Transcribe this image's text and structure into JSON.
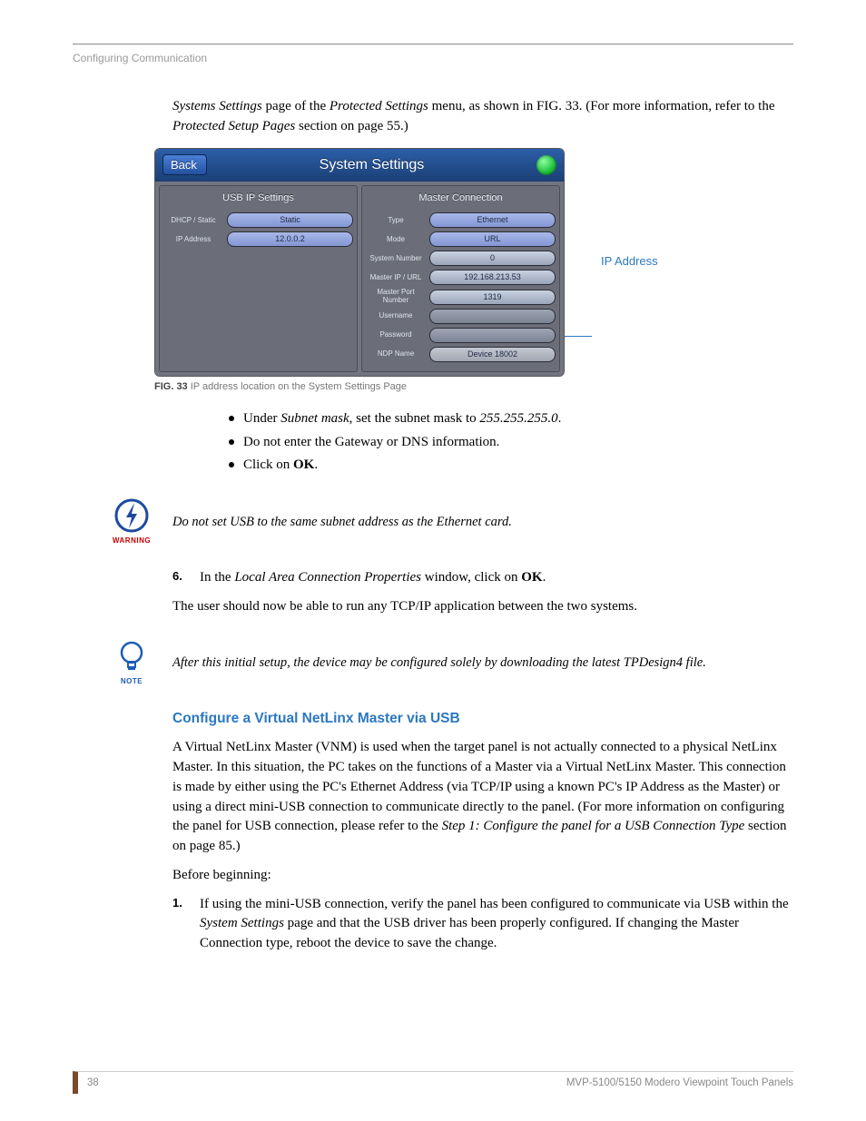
{
  "running_head": "Configuring Communication",
  "intro": {
    "pre": "Systems Settings",
    "mid1": " page of the ",
    "i2": "Protected Settings",
    "mid2": " menu, as shown in FIG. 33. (For more information, refer to the ",
    "i3": "Protected Setup Pages",
    "tail": " section on page 55.)"
  },
  "panel": {
    "back": "Back",
    "title": "System Settings",
    "cols": {
      "left": {
        "head": "USB IP Settings",
        "rows": [
          {
            "label": "DHCP / Static",
            "value": "Static"
          },
          {
            "label": "IP Address",
            "value": "12.0.0.2"
          }
        ]
      },
      "right": {
        "head": "Master Connection",
        "rows": [
          {
            "label": "Type",
            "value": "Ethernet"
          },
          {
            "label": "Mode",
            "value": "URL"
          },
          {
            "label": "System Number",
            "value": "0"
          },
          {
            "label": "Master IP / URL",
            "value": "192.168.213.53"
          },
          {
            "label": "Master Port Number",
            "value": "1319"
          },
          {
            "label": "Username",
            "value": ""
          },
          {
            "label": "Password",
            "value": ""
          },
          {
            "label": "NDP Name",
            "value": "Device 18002"
          }
        ]
      }
    }
  },
  "callout": "IP Address",
  "figure": {
    "label": "FIG. 33",
    "caption": "  IP address location on the System Settings Page"
  },
  "bullets": [
    {
      "pre": "Under ",
      "i": "Subnet mask",
      "mid": ", set the subnet mask to ",
      "i2": "255.255.255.0",
      "post": "."
    },
    {
      "text": "Do not enter the Gateway or DNS information."
    },
    {
      "pre": "Click on ",
      "b": "OK",
      "post": "."
    }
  ],
  "warning": {
    "label": "WARNING",
    "text": "Do not set USB to the same subnet address as the Ethernet card."
  },
  "step6": {
    "n": "6.",
    "pre": "In the ",
    "i": "Local Area Connection Properties",
    "mid": " window, click on ",
    "b": "OK",
    "post": "."
  },
  "after6": "The user should now be able to run any TCP/IP application between the two systems.",
  "note": {
    "label": "NOTE",
    "text": "After this initial setup, the device may be configured solely by downloading the latest TPDesign4 file."
  },
  "heading": "Configure a Virtual NetLinx Master via USB",
  "vnm_para": {
    "a": "A Virtual NetLinx Master (VNM) is used when the target panel is not actually connected to a physical NetLinx Master. In this situation, the PC takes on the functions of a Master via a Virtual NetLinx Master. This connection is made by either using the PC's Ethernet Address (via TCP/IP using a known PC's IP Address as the Master) or using a direct mini-USB connection to communicate directly to the panel. (For more information on configuring the panel for USB connection, please refer to the ",
    "i": "Step 1: Configure the panel for a USB Connection Type",
    "b": " section on page 85.)"
  },
  "before": "Before beginning:",
  "step1": {
    "n": "1.",
    "a": "If using the mini-USB connection, verify the panel has been configured to communicate via USB within the ",
    "i": "System Settings",
    "b": " page and that the USB driver has been properly configured. If changing the Master Connection type, reboot the device to save the change."
  },
  "footer": {
    "page": "38",
    "doc": "MVP-5100/5150 Modero Viewpoint  Touch Panels"
  }
}
